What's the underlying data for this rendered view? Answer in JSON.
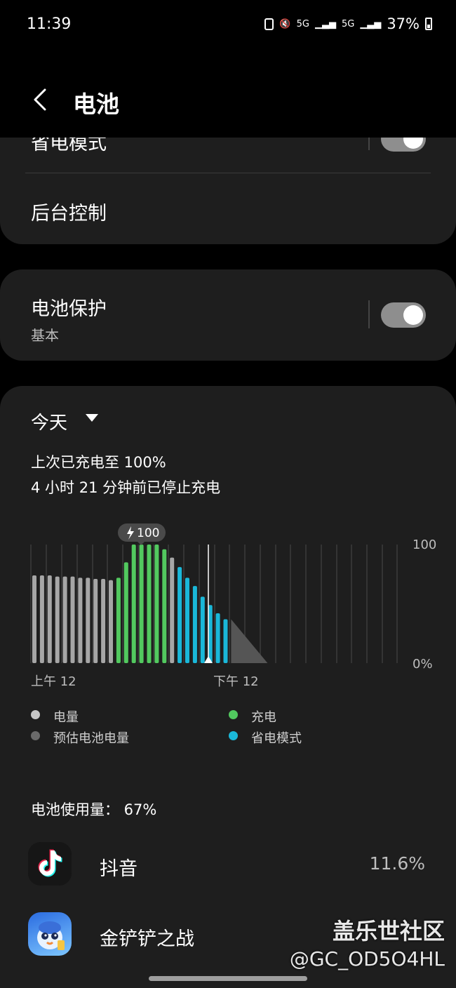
{
  "status_bar": {
    "time": "11:39",
    "signal1": "5G",
    "signal2": "5G",
    "battery_pct": "37%"
  },
  "header": {
    "title": "电池"
  },
  "rows": {
    "power_saving": "省电模式",
    "background_control": "后台控制"
  },
  "battery_protection": {
    "label": "电池保护",
    "sub": "基本",
    "enabled": true
  },
  "usage_card": {
    "period": "今天",
    "last_charged": "上次已充电至 100%",
    "stopped_charging": "4 小时 21 分钟前已停止充电",
    "usage_total": "电池使用量： 67%"
  },
  "chart_data": {
    "type": "bar",
    "badge": "100",
    "y_ticks": [
      "100",
      "0%"
    ],
    "x_ticks": [
      "上午 12",
      "下午 12"
    ],
    "ylim": [
      0,
      100
    ],
    "series": [
      {
        "name": "电量",
        "color": "#a6a6a6",
        "values": [
          74,
          74,
          74,
          73,
          73,
          73,
          72,
          72,
          71,
          71,
          70
        ]
      },
      {
        "name": "充电",
        "color": "#52c95f",
        "values": [
          72,
          85,
          100,
          100,
          100,
          100,
          96
        ]
      },
      {
        "name": "电量",
        "color": "#a6a6a6",
        "values": [
          89
        ]
      },
      {
        "name": "省电模式",
        "color": "#1ab8d9",
        "values": [
          81,
          72,
          65,
          56,
          49,
          42,
          37
        ]
      }
    ],
    "predicted": {
      "name": "预估电池电量",
      "color": "#555555",
      "from": 37,
      "to": 0
    }
  },
  "legend": [
    {
      "label": "电量",
      "color": "#c6c6c6"
    },
    {
      "label": "充电",
      "color": "#52c95f"
    },
    {
      "label": "预估电池电量",
      "color": "#6a6a6a"
    },
    {
      "label": "省电模式",
      "color": "#1ab8d9"
    }
  ],
  "apps": [
    {
      "name": "抖音",
      "pct": "11.6%",
      "icon": "douyin-icon"
    },
    {
      "name": "金铲铲之战",
      "pct": "",
      "icon": "game-icon"
    }
  ],
  "watermark": {
    "line1": "盖乐世社区",
    "line2": "@GC_OD5O4HL"
  }
}
